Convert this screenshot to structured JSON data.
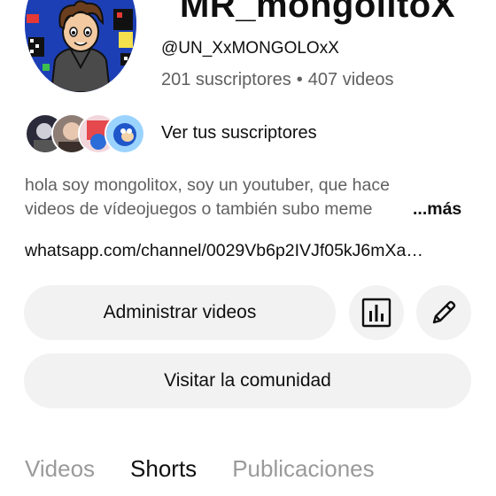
{
  "channel": {
    "name": "MR_mongolitoX",
    "handle": "@UN_XxMONGOLOxX",
    "subscribers": "201 suscriptores",
    "separator": "•",
    "videos": "407 videos"
  },
  "subscribers_link": "Ver tus suscriptores",
  "description": {
    "line1": "hola soy mongolitox, soy un youtuber, que hace",
    "line2": "videos de vídeojuegos o también subo meme",
    "more": "...más"
  },
  "external_link": "whatsapp.com/channel/0029Vb6p2IVJf05kJ6mXa…",
  "buttons": {
    "manage_videos": "Administrar videos",
    "visit_community": "Visitar la comunidad"
  },
  "icons": {
    "stats": "analytics-icon",
    "edit": "pencil-icon"
  },
  "tabs": [
    {
      "label": "Videos",
      "active": false
    },
    {
      "label": "Shorts",
      "active": true
    },
    {
      "label": "Publicaciones",
      "active": false
    }
  ]
}
